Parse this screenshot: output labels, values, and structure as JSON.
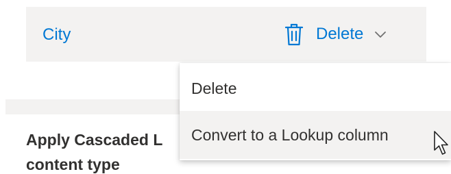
{
  "field_row": {
    "name": "City",
    "delete_label": "Delete",
    "trash_icon": "trash-icon",
    "chevron_icon": "chevron-down-icon",
    "accent_color": "#0078d4",
    "row_background": "#f3f2f1"
  },
  "dropdown": {
    "items": [
      {
        "label": "Delete"
      },
      {
        "label": "Convert to a Lookup column",
        "hovered": true
      }
    ]
  },
  "section": {
    "heading": "Apply Cascaded L content type"
  },
  "cursor_icon": "mouse-pointer-icon"
}
